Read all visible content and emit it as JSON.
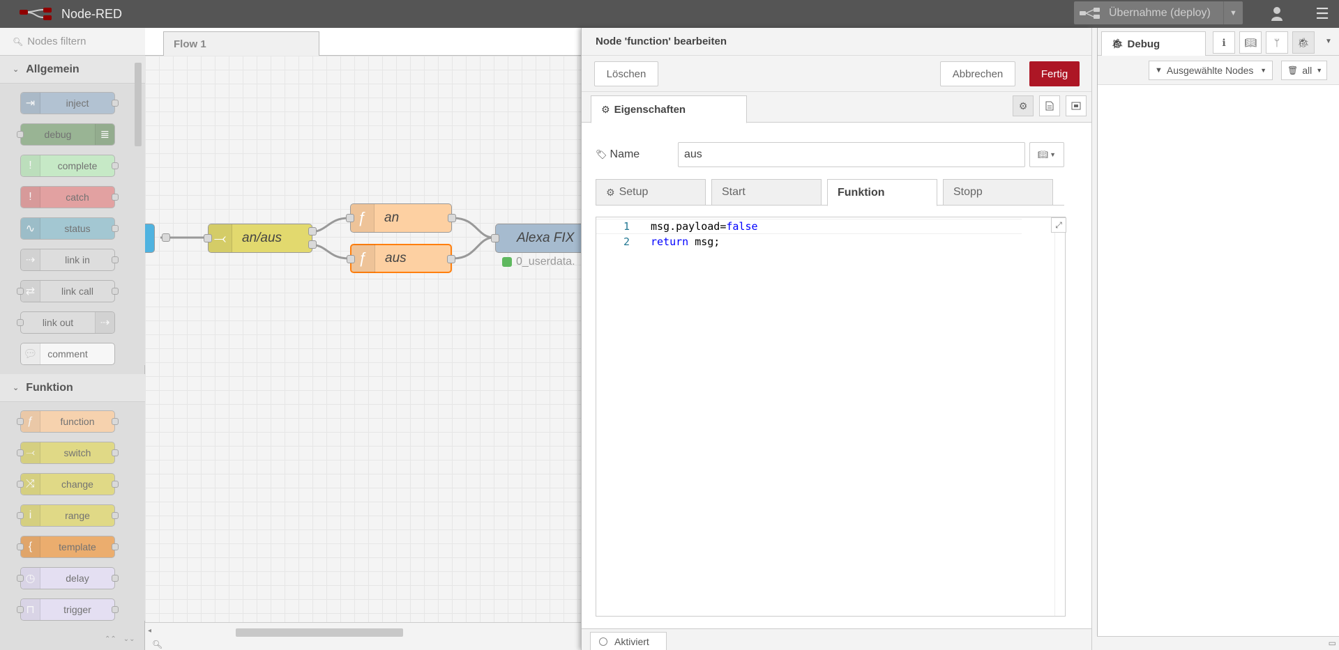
{
  "header": {
    "title": "Node-RED",
    "deploy_label": "Übernahme (deploy)"
  },
  "palette": {
    "search_placeholder": "Nodes filtern",
    "categories": [
      {
        "name": "Allgemein",
        "nodes": [
          {
            "label": "inject",
            "color": "#a6bbcf",
            "icon_side": "left",
            "icon": "arrow-in-icon",
            "in": false,
            "out": true
          },
          {
            "label": "debug",
            "color": "#87a980",
            "icon_side": "right",
            "icon": "list-icon",
            "in": true,
            "out": false
          },
          {
            "label": "complete",
            "color": "#c0edc0",
            "icon_side": "left",
            "icon": "exclamation-icon",
            "in": false,
            "out": true
          },
          {
            "label": "catch",
            "color": "#e49191",
            "icon_side": "left",
            "icon": "exclamation-icon",
            "in": false,
            "out": true
          },
          {
            "label": "status",
            "color": "#94c1d0",
            "icon_side": "left",
            "icon": "pulse-icon",
            "in": false,
            "out": true
          },
          {
            "label": "link in",
            "color": "#dddddd",
            "icon_side": "left",
            "icon": "link-in-icon",
            "in": false,
            "out": true
          },
          {
            "label": "link call",
            "color": "#dddddd",
            "icon_side": "left",
            "icon": "link-call-icon",
            "in": true,
            "out": true
          },
          {
            "label": "link out",
            "color": "#dddddd",
            "icon_side": "right",
            "icon": "link-out-icon",
            "in": true,
            "out": false
          },
          {
            "label": "comment",
            "color": "#ffffff",
            "icon_side": "left",
            "icon": "comment-icon",
            "in": false,
            "out": false
          }
        ]
      },
      {
        "name": "Funktion",
        "nodes": [
          {
            "label": "function",
            "color": "#fdd0a2",
            "icon_side": "left",
            "icon": "function-icon",
            "in": true,
            "out": true
          },
          {
            "label": "switch",
            "color": "#e2d96e",
            "icon_side": "left",
            "icon": "switch-icon",
            "in": true,
            "out": true
          },
          {
            "label": "change",
            "color": "#e2d96e",
            "icon_side": "left",
            "icon": "shuffle-icon",
            "in": true,
            "out": true
          },
          {
            "label": "range",
            "color": "#e2d96e",
            "icon_side": "left",
            "icon": "range-icon",
            "in": true,
            "out": true
          },
          {
            "label": "template",
            "color": "#f0a050",
            "icon_side": "left",
            "icon": "template-icon",
            "in": true,
            "out": true
          },
          {
            "label": "delay",
            "color": "#e6e0f8",
            "icon_side": "left",
            "icon": "timer-icon",
            "in": true,
            "out": true
          },
          {
            "label": "trigger",
            "color": "#e6e0f8",
            "icon_side": "left",
            "icon": "trigger-icon",
            "in": true,
            "out": true
          }
        ]
      }
    ]
  },
  "workspace": {
    "tab_label": "Flow 1",
    "nodes": {
      "switch": {
        "label": "an/aus",
        "color": "#e2d96e"
      },
      "fn_an": {
        "label": "an",
        "color": "#fdd0a2"
      },
      "fn_aus": {
        "label": "aus",
        "color": "#fdd0a2"
      },
      "alexa": {
        "label": "Alexa FIX",
        "color": "#a6bbcf"
      },
      "alexa_status": "0_userdata."
    }
  },
  "editor": {
    "title": "Node 'function' bearbeiten",
    "delete_label": "Löschen",
    "cancel_label": "Abbrechen",
    "done_label": "Fertig",
    "properties_tab": "Eigenschaften",
    "name_label": "Name",
    "name_value": "aus",
    "subtabs": [
      "Setup",
      "Start",
      "Funktion",
      "Stopp"
    ],
    "active_subtab": "Funktion",
    "code_lines": [
      {
        "num": "1",
        "parts": [
          {
            "t": "msg.payload=",
            "c": "plain"
          },
          {
            "t": "false",
            "c": "kw"
          }
        ]
      },
      {
        "num": "2",
        "parts": [
          {
            "t": "return",
            "c": "kw"
          },
          {
            "t": " msg;",
            "c": "plain"
          }
        ]
      }
    ],
    "enabled_label": "Aktiviert"
  },
  "sidebar": {
    "tab_label": "Debug",
    "filter_label": "Ausgewählte Nodes",
    "clear_label": "all"
  },
  "colors": {
    "header_bg": "#555555",
    "primary_button": "#ad1625",
    "code_keyword": "#0000ff",
    "line_number": "#237893"
  }
}
